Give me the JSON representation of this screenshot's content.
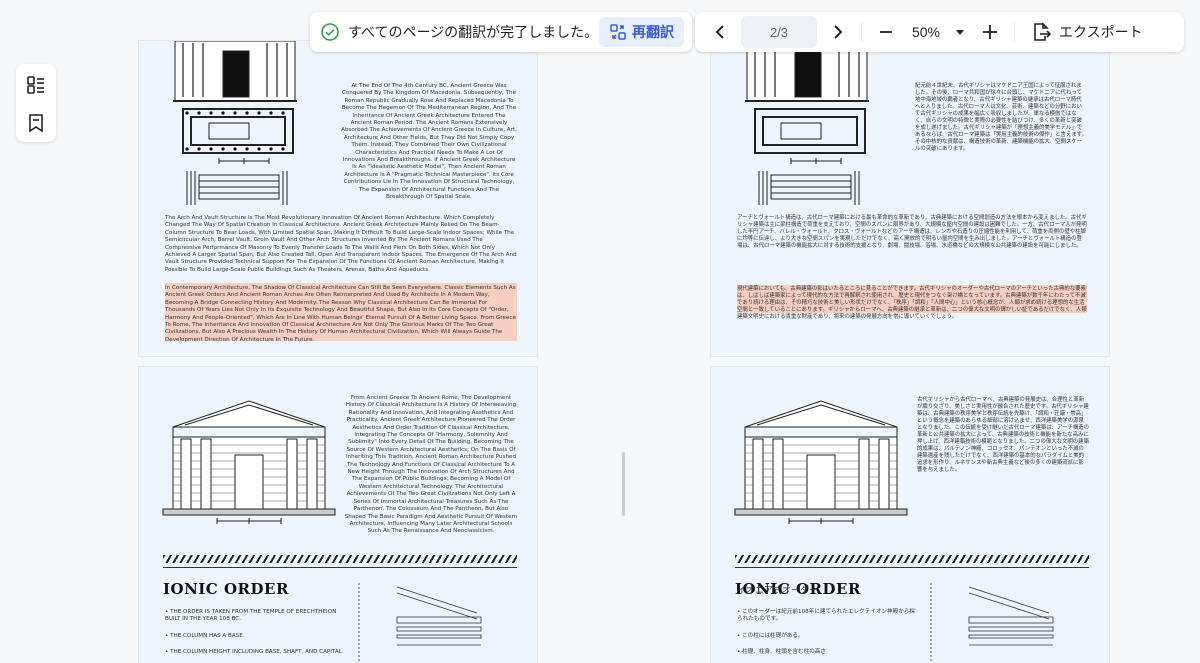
{
  "toolbar": {
    "status_text": "すべてのページの翻訳が完了しました。",
    "retranslate_label": "再翻訳",
    "page_indicator": "2/3",
    "zoom": "50%",
    "export_label": "エクスポート"
  },
  "colors": {
    "accent": "#3b5bdb",
    "success": "#2f9e44",
    "highlight": "#f6cfc0"
  },
  "icons": [
    "check-circle-icon",
    "retranslate-icon",
    "chevron-left-icon",
    "chevron-right-icon",
    "minus-icon",
    "plus-icon",
    "caret-down-icon",
    "export-icon",
    "thumbnails-icon",
    "bookmark-icon"
  ],
  "pageA": {
    "para1": "At The End Of The 4th Century BC, Ancient Greece Was Conquered By The Kingdom Of Macedonia. Subsequently, The Roman Republic Gradually Rose And Replaced Macedonia To Become The Hegemon Of The Mediterranean Region, And The Inheritance Of Ancient Greek Architecture Entered The Ancient Roman Period. The Ancient Romans Extensively Absorbed The Achievements Of Ancient Greece In Culture, Art, Architecture And Other Fields, But They Did Not Simply Copy Them. Instead, They Combined Their Own Civilizational Characteristics And Practical Needs To Make A Lot Of Innovations And Breakthroughs. If Ancient Greek Architecture Is An \"Idealistic Aesthetic Model\", Then Ancient Roman Architecture Is A \"Pragmatic Technical Masterpiece\". Its Core Contributions Lie In The Innovation Of Structural Technology, The Expansion Of Architectural Functions And The Breakthrough Of Spatial Scale.",
    "para2": "The Arch And Vault Structure Is The Most Revolutionary Innovation Of Ancient Roman Architecture, Which Completely Changed The Way Of Spatial Creation In Classical Architecture. Ancient Greek Architecture Mainly Relied On The Beam-Column Structure To Bear Loads, With Limited Spatial Span, Making It Difficult To Build Large-Scale Indoor Spaces; While The Semicircular Arch, Barrel Vault, Groin Vault And Other Arch Structures Invented By The Ancient Romans Used The Compressive Performance Of Masonry To Evenly Transfer Loads To The Walls And Piers On Both Sides, Which Not Only Achieved A Larger Spatial Span, But Also Created Tall, Open And Transparent Indoor Spaces. The Emergence Of The Arch And Vault Structure Provided Technical Support For The Expansion Of The Functions Of Ancient Roman Architecture, Making It Possible To Build Large-Scale Public Buildings Such As Theaters, Arenas, Baths And Aqueducts.",
    "para3": "In Contemporary Architecture, The Shadow Of Classical Architecture Can Still Be Seen Everywhere. Classic Elements Such As Ancient Greek Orders And Ancient Roman Arches Are Often Reinterpreted And Used By Architects In A Modern Way, Becoming A Bridge Connecting History And Modernity. The Reason Why Classical Architecture Can Be Immortal For Thousands Of Years Lies Not Only In Its Exquisite Technology And Beautiful Shape, But Also In Its Core Concepts Of \"Order, Harmony And People-Oriented\", Which Are In Line With Human Beings' Eternal Pursuit Of A Better Living Space. From Greece To Rome, The Inheritance And Innovation Of Classical Architecture Are Not Only The Glorious Marks Of The Two Great Civilizations, But Also A Precious Wealth In The History Of Human Architectural Civilization, Which Will Always Guide The Development Direction Of Architecture In The Future."
  },
  "pageB": {
    "para1": "紀元前４世紀末、古代ギリシャはマケドニア王国によって征服されました。その後、ローマ共和国が徐々に台頭し、マケドニアに代わって地中海地域の覇者となり、古代ギリシャ建築の継承は古代ローマ時代へと入りました。古代ローマ人は文化、芸術、建築などの分野において古代ギリシャの成果を幅広く吸収しましたが、単なる模倣ではなく、自らの文明の特徴と実際の必要性を結びつけ、多くの革新と突破を成し遂げました。古代ギリシャ建築が「理想主義的美学モデル」であるならば、古代ローマ建築は「実用主義的技術の傑作」と言えます。その中核的な貢献は、構造技術の革新、建築機能の拡大、空間スケールの突破にあります。",
    "para2": "アーチとヴォールト構造は、古代ローマ建築における最も革命的な革新であり、古典建築における空間創造の方法を根本から変えました。古代ギリシャ建築は主に梁柱構造で荷重を支えており、空間のスパンに限界があり、大規模な屋内空間の建設は困難でした。一方、古代ローマ人が発明した半円アーチ、バレル・ヴォールト、クロス・ヴォールトなどのアーチ構造は、レンガや石造りの圧縮性能を利用して、荷重を両側の壁や柱脚に均等に伝達し、より大きな空間スパンを実現しただけでなく、高く開放的で明るい屋内空間を生み出しました。アーチとヴォールト構造の登場は、古代ローマ建築の機能拡大に対する技術的支援となり、劇場、闘技場、浴場、水道橋などの大規模な公共建築の建設を可能にしました。",
    "para3": "現代建築においても、古典建築の影はいたるところに見ることができます。古代ギリシャのオーダーや古代ローマのアーチといった古典的な要素は、しばしば建築家によって現代的な方法で再解釈され使用され、歴史と現代をつなぐ架け橋となっています。古典建築が数千年にわたって不滅であり続ける理由は、その精巧な技術と美しい形状だけでなく、「秩序」「調和」「人間中心」という核心概念が、人類が求め続ける理想的な生活空間と一致していることにあります。ギリシャからローマへ、古典建築の継承と革新は、二つの偉大な文明の輝かしい証であるだけでなく、人類建築文明史における貴重な財産であり、将来の建築の発展方向を常に導いていくでしょう。"
  },
  "pageC": {
    "para1": "From Ancient Greece To Ancient Rome, The Development History Of Classical Architecture Is A History Of Interweaving Rationality And Innovation, And Integrating Aesthetics And Practicality. Ancient Greek Architecture Pioneered The Order Aesthetics And Order Tradition Of Classical Architecture, Integrating The Concepts Of \"Harmony, Solemnity And Sublimity\" Into Every Detail Of The Building, Becoming The Source Of Western Architectural Aesthetics; On The Basis Of Inheriting This Tradition, Ancient Roman Architecture Pushed The Technology And Functions Of Classical Architecture To A New Height Through The Innovation Of Arch Structures And The Expansion Of Public Buildings, Becoming A Model Of Western Architectural Technology. The Architectural Achievements Of The Two Great Civilizations Not Only Left A Series Of Immortal Architectural Treasures Such As The Parthenon, The Colosseum And The Pantheon, But Also Shaped The Basic Paradigm And Aesthetic Pursuit Of Western Architecture, Influencing Many Later Architectural Schools Such As The Renaissance And Neoclassicism.",
    "heading": "IONIC ORDER",
    "bullets": [
      "THE ORDER IS TAKEN FROM THE TEMPLE OF ERECHTHEION BUILT IN THE YEAR 108 BC.",
      "THE COLUMN HAS A BASE.",
      "THE COLUMN HEIGHT INCLUDING BASE, SHAFT, AND CAPITAL"
    ]
  },
  "pageD": {
    "para1": "古代ギリシャから古代ローマへ、古典建築の発展史は、合理性と革新が織り交ざり、美しさと実用性が融合された歴史です。古代ギリシャ建築は、古典建築の秩序美学と秩序伝統を先駆け、「調和・荘厳・崇高」という概念を建築のあらゆる細部に溶け込ませ、西洋建築美学の源泉となりました。この伝統を受け継いだ古代ローマ建築は、アーチ構造の革新と公共建築の拡大によって、古典建築の技術と機能を新たな高みに押し上げ、西洋建築技術の模範となりました。二つの偉大な文明の建築的成果は、パルテノン神殿、コロッセオ、パンテオンといった不滅の建築遺産を残しただけでなく、西洋建築の基本的なパラダイムと美的追求を形作り、ルネサンスや新古典主義など後の多くの建築流派に影響を与えました。",
    "heading": "IONIC ORDER",
    "heading_overlay": "イオニア式オーダー",
    "bullets": [
      "このオーダーは紀元前108年に建てられたエレクテイオン神殿から採られたものです。",
      "この柱には柱礎がある。",
      "柱礎、柱身、柱頭を含む柱の高さ"
    ]
  }
}
